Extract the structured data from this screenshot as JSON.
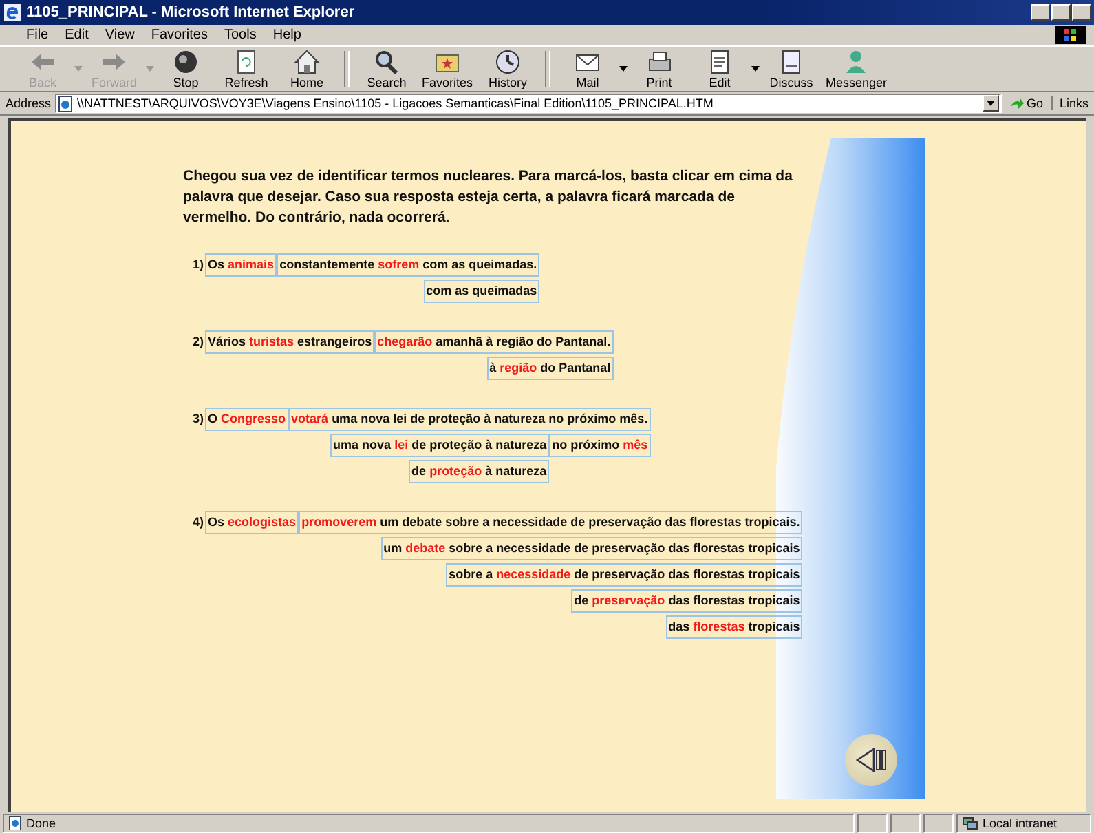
{
  "window": {
    "title": "1105_PRINCIPAL - Microsoft Internet Explorer"
  },
  "menu": [
    "File",
    "Edit",
    "View",
    "Favorites",
    "Tools",
    "Help"
  ],
  "toolbar_groups": [
    [
      {
        "label": "Back",
        "kind": "back",
        "disabled": true,
        "menu_arrow": true
      },
      {
        "label": "Forward",
        "kind": "forward",
        "disabled": true,
        "menu_arrow": true
      },
      {
        "label": "Stop",
        "kind": "stop",
        "disabled": false,
        "menu_arrow": false
      },
      {
        "label": "Refresh",
        "kind": "refresh",
        "disabled": false,
        "menu_arrow": false
      },
      {
        "label": "Home",
        "kind": "home",
        "disabled": false,
        "menu_arrow": false
      }
    ],
    [
      {
        "label": "Search",
        "kind": "search",
        "disabled": false,
        "menu_arrow": false
      },
      {
        "label": "Favorites",
        "kind": "favorites",
        "disabled": false,
        "menu_arrow": false
      },
      {
        "label": "History",
        "kind": "history",
        "disabled": false,
        "menu_arrow": false
      }
    ],
    [
      {
        "label": "Mail",
        "kind": "mail",
        "disabled": false,
        "menu_arrow": true
      },
      {
        "label": "Print",
        "kind": "print",
        "disabled": false,
        "menu_arrow": false
      },
      {
        "label": "Edit",
        "kind": "edit",
        "disabled": false,
        "menu_arrow": true
      },
      {
        "label": "Discuss",
        "kind": "discuss",
        "disabled": false,
        "menu_arrow": false
      },
      {
        "label": "Messenger",
        "kind": "messenger",
        "disabled": false,
        "menu_arrow": false
      }
    ]
  ],
  "address": {
    "label": "Address",
    "value": "\\\\NATTNEST\\ARQUIVOS\\VOY3E\\Viagens Ensino\\1105 - Ligacoes Semanticas\\Final Edition\\1105_PRINCIPAL.HTM",
    "go": "Go",
    "links": "Links"
  },
  "intro": "Chegou sua vez de identificar termos nucleares. Para marcá-los, basta clicar em cima da palavra que desejar. Caso sua resposta esteja certa, a palavra ficará marcada de vermelho. Do contrário, nada ocorrerá.",
  "sentences": [
    {
      "number": "1)",
      "segments": [
        {
          "parts": [
            {
              "text": "Os ",
              "marked": false
            },
            {
              "text": "animais",
              "marked": true
            }
          ]
        },
        {
          "parts": [
            {
              "text": "constantemente ",
              "marked": false
            },
            {
              "text": "sofrem",
              "marked": true
            },
            {
              "text": " com as queimadas.",
              "marked": false
            }
          ],
          "children": [
            {
              "parts": [
                {
                  "text": "com as queimadas",
                  "marked": false
                }
              ]
            }
          ]
        }
      ]
    },
    {
      "number": "2)",
      "segments": [
        {
          "parts": [
            {
              "text": "Vários ",
              "marked": false
            },
            {
              "text": "turistas",
              "marked": true
            },
            {
              "text": " estrangeiros",
              "marked": false
            }
          ]
        },
        {
          "parts": [
            {
              "text": "chegarão",
              "marked": true
            },
            {
              "text": " amanhã à região do Pantanal.",
              "marked": false
            }
          ],
          "children": [
            {
              "parts": [
                {
                  "text": "à ",
                  "marked": false
                },
                {
                  "text": "região",
                  "marked": true
                },
                {
                  "text": " do Pantanal",
                  "marked": false
                }
              ]
            }
          ]
        }
      ]
    },
    {
      "number": "3)",
      "segments": [
        {
          "parts": [
            {
              "text": "O ",
              "marked": false
            },
            {
              "text": "Congresso",
              "marked": true
            }
          ]
        },
        {
          "parts": [
            {
              "text": "votará",
              "marked": true
            },
            {
              "text": " uma nova lei de proteção à natureza no próximo mês.",
              "marked": false
            }
          ],
          "children": [
            {
              "parts": [
                {
                  "text": "uma nova ",
                  "marked": false
                },
                {
                  "text": "lei",
                  "marked": true
                },
                {
                  "text": " de proteção à natureza",
                  "marked": false
                }
              ],
              "children": [
                {
                  "parts": [
                    {
                      "text": "de ",
                      "marked": false
                    },
                    {
                      "text": "proteção",
                      "marked": true
                    },
                    {
                      "text": " à natureza",
                      "marked": false
                    }
                  ]
                }
              ]
            },
            {
              "parts": [
                {
                  "text": "no próximo ",
                  "marked": false
                },
                {
                  "text": "mês",
                  "marked": true
                }
              ]
            }
          ]
        }
      ]
    },
    {
      "number": "4)",
      "segments": [
        {
          "parts": [
            {
              "text": "Os ",
              "marked": false
            },
            {
              "text": "ecologistas",
              "marked": true
            }
          ]
        },
        {
          "parts": [
            {
              "text": "promoverem",
              "marked": true
            },
            {
              "text": " um debate sobre a necessidade de preservação das florestas tropicais.",
              "marked": false
            }
          ],
          "children": [
            {
              "parts": [
                {
                  "text": "um ",
                  "marked": false
                },
                {
                  "text": "debate",
                  "marked": true
                },
                {
                  "text": " sobre a necessidade de preservação das florestas tropicais",
                  "marked": false
                }
              ],
              "children": [
                {
                  "parts": [
                    {
                      "text": "sobre a ",
                      "marked": false
                    },
                    {
                      "text": "necessidade",
                      "marked": true
                    },
                    {
                      "text": " de preservação das florestas tropicais",
                      "marked": false
                    }
                  ],
                  "children": [
                    {
                      "parts": [
                        {
                          "text": "de ",
                          "marked": false
                        },
                        {
                          "text": "preservação",
                          "marked": true
                        },
                        {
                          "text": " das florestas tropicais",
                          "marked": false
                        }
                      ],
                      "children": [
                        {
                          "parts": [
                            {
                              "text": "das ",
                              "marked": false
                            },
                            {
                              "text": "florestas",
                              "marked": true
                            },
                            {
                              "text": " tropicais",
                              "marked": false
                            }
                          ]
                        }
                      ]
                    }
                  ]
                }
              ]
            }
          ]
        }
      ]
    }
  ],
  "status_bar": {
    "text": "Done",
    "zone": "Local intranet"
  }
}
